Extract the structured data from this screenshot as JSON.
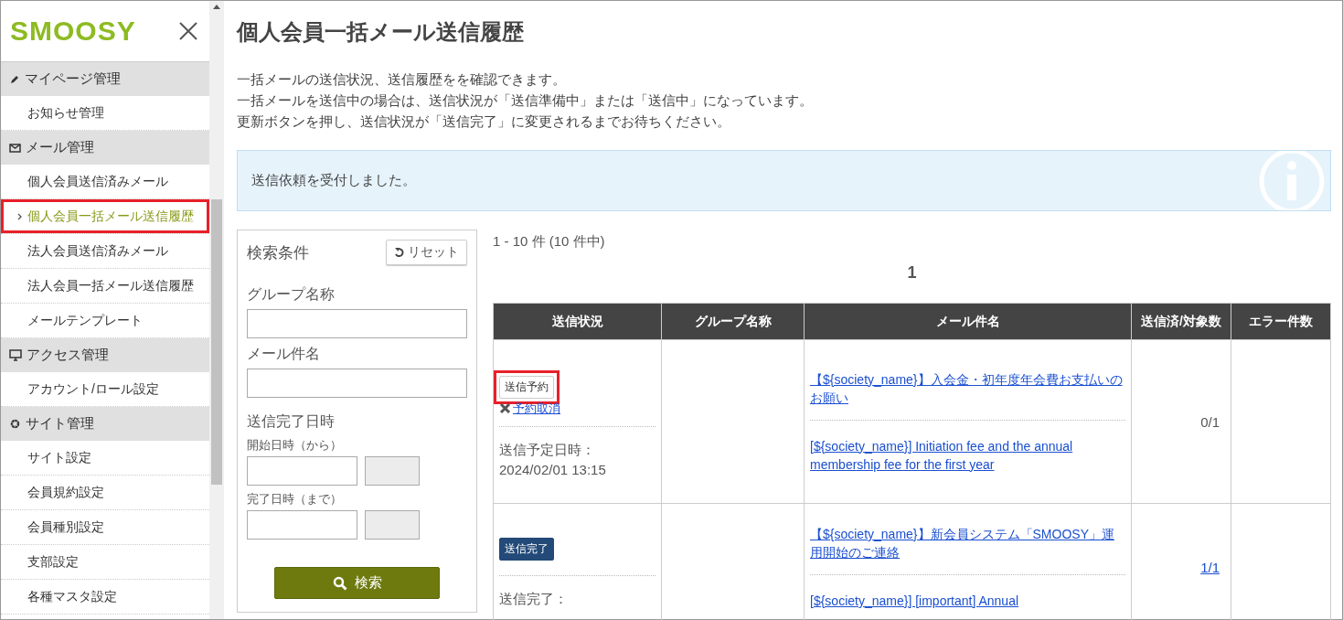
{
  "sidebar": {
    "logo": "SMOOSY",
    "sections": [
      {
        "label": "マイページ管理",
        "items": [
          {
            "label": "お知らせ管理",
            "selected": false,
            "highlighted": false
          }
        ]
      },
      {
        "label": "メール管理",
        "items": [
          {
            "label": "個人会員送信済みメール",
            "selected": false,
            "highlighted": false
          },
          {
            "label": "個人会員一括メール送信履歴",
            "selected": true,
            "highlighted": true
          },
          {
            "label": "法人会員送信済みメール",
            "selected": false,
            "highlighted": false
          },
          {
            "label": "法人会員一括メール送信履歴",
            "selected": false,
            "highlighted": false
          },
          {
            "label": "メールテンプレート",
            "selected": false,
            "highlighted": false
          }
        ]
      },
      {
        "label": "アクセス管理",
        "items": [
          {
            "label": "アカウント/ロール設定",
            "selected": false,
            "highlighted": false
          }
        ]
      },
      {
        "label": "サイト管理",
        "items": [
          {
            "label": "サイト設定",
            "selected": false,
            "highlighted": false
          },
          {
            "label": "会員規約設定",
            "selected": false,
            "highlighted": false
          },
          {
            "label": "会員種別設定",
            "selected": false,
            "highlighted": false
          },
          {
            "label": "支部設定",
            "selected": false,
            "highlighted": false
          },
          {
            "label": "各種マスタ設定",
            "selected": false,
            "highlighted": false
          }
        ]
      }
    ]
  },
  "page": {
    "title": "個人会員一括メール送信履歴",
    "description": [
      "一括メールの送信状況、送信履歴をを確認できます。",
      "一括メールを送信中の場合は、送信状況が「送信準備中」または「送信中」になっています。",
      "更新ボタンを押し、送信状況が「送信完了」に変更されるまでお待ちください。"
    ],
    "notice": "送信依頼を受付しました。"
  },
  "search": {
    "title": "検索条件",
    "reset": "リセット",
    "fields": [
      {
        "label": "グループ名称"
      },
      {
        "label": "メール件名"
      }
    ],
    "date_title": "送信完了日時",
    "ranges": [
      {
        "label": "開始日時（から）"
      },
      {
        "label": "完了日時（まで）"
      }
    ],
    "submit": "検索"
  },
  "results": {
    "summary": "1 - 10 件 (10 件中)",
    "pages": [
      {
        "label": "1",
        "selected": true
      }
    ],
    "columns": [
      "送信状況",
      "グループ名称",
      "メール件名",
      "送信済/対象数",
      "エラー件数"
    ],
    "rows": [
      {
        "status": {
          "label": "送信予約",
          "kind": "scheduled",
          "highlighted": true
        },
        "cancel": "予約取消",
        "date_label": "送信予定日時：",
        "date": "2024/02/01 13:15",
        "subjects": [
          "【${society_name}】入会金・初年度年会費お支払いのお願い",
          "[${society_name}] Initiation fee and the annual membership fee for the first year"
        ],
        "count": "0/1",
        "count_linked": false
      },
      {
        "status": {
          "label": "送信完了",
          "kind": "done",
          "highlighted": false
        },
        "date_label": "送信完了：",
        "subjects": [
          "【${society_name}】新会員システム「SMOOSY」運用開始のご連絡",
          "[${society_name}] [important] Annual"
        ],
        "count": "1/1",
        "count_linked": true
      }
    ]
  }
}
